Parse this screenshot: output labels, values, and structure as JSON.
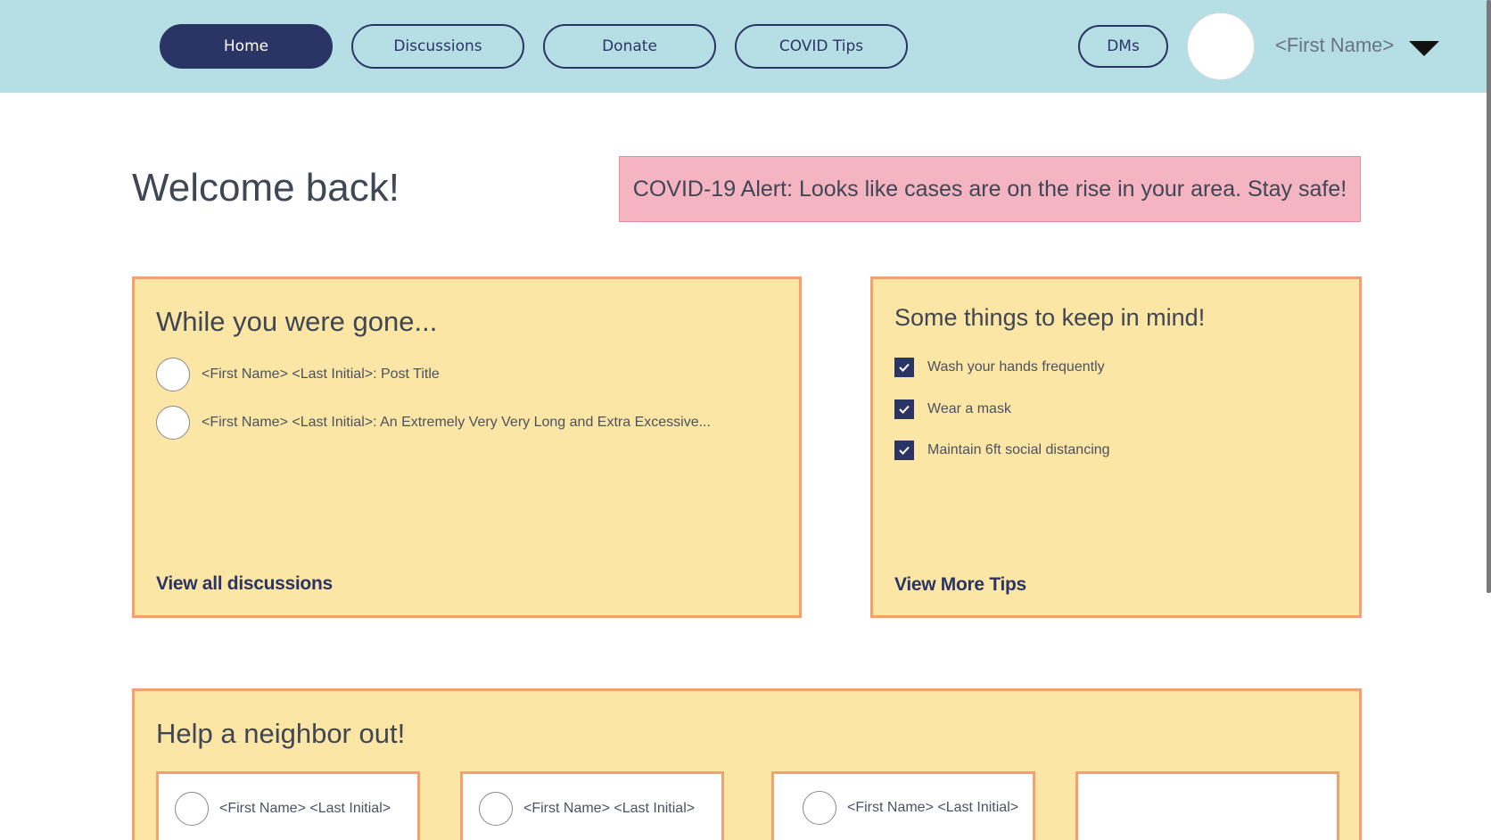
{
  "nav": {
    "tabs": [
      {
        "label": "Home",
        "active": true
      },
      {
        "label": "Discussions",
        "active": false
      },
      {
        "label": "Donate",
        "active": false
      },
      {
        "label": "COVID Tips",
        "active": false
      }
    ],
    "dms_label": "DMs",
    "user_name": "<First Name>",
    "dropdown_icon": "caret-down-icon"
  },
  "welcome": "Welcome back!",
  "alert": "COVID-19 Alert: Looks like cases are on the rise in your area. Stay safe!",
  "gone": {
    "title": "While you were gone...",
    "posts": [
      "<First Name>  <Last Initial>: Post Title",
      "<First Name>  <Last Initial>: An Extremely Very Very Long and Extra Excessive..."
    ],
    "link": "View all discussions"
  },
  "tips": {
    "title": "Some things to keep in mind!",
    "items": [
      "Wash your hands frequently",
      "Wear a mask",
      "Maintain 6ft social distancing"
    ],
    "link": "View More Tips"
  },
  "neighbor": {
    "title": "Help a neighbor out!",
    "cards": [
      "<First Name>  <Last Initial>",
      "<First Name>  <Last Initial>",
      "<First Name>  <Last Initial>",
      ""
    ]
  },
  "colors": {
    "nav_bg": "#b5dfe4",
    "accent": "#2b3565",
    "alert_bg": "#f5b4c1",
    "card_bg": "#fbe6a5",
    "card_border": "#f3a06f"
  }
}
